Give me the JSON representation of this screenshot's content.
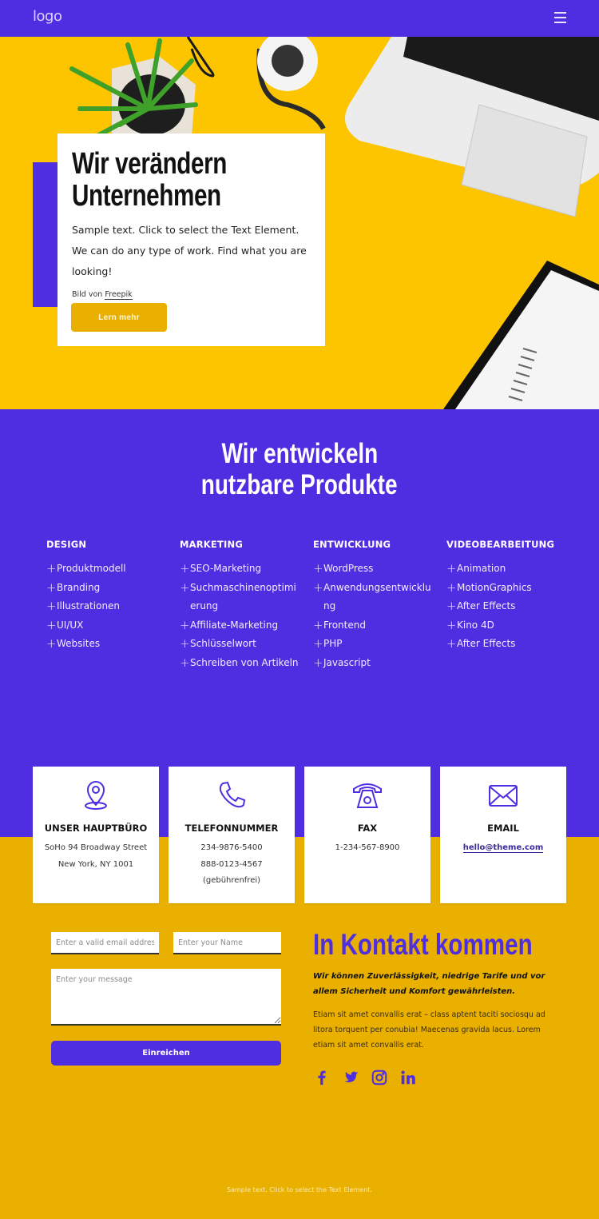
{
  "header": {
    "logo": "logo",
    "menu_icon": "hamburger-menu-icon"
  },
  "hero": {
    "title_line1": "Wir verändern",
    "title_line2": "Unternehmen",
    "text": "Sample text. Click to select the Text Element. We can do any type of work. Find what you are looking!",
    "credit_prefix": "Bild von",
    "credit_link": "Freepik",
    "button": "Lern mehr"
  },
  "products": {
    "title_line1": "Wir entwickeln",
    "title_line2": "nutzbare Produkte",
    "columns": [
      {
        "heading": "DESIGN",
        "items": [
          "Produktmodell",
          "Branding",
          "Illustrationen",
          "UI/UX",
          "Websites"
        ]
      },
      {
        "heading": "MARKETING",
        "items": [
          "SEO-Marketing",
          "Suchmaschinenoptimierung",
          "Affiliate-Marketing",
          "Schlüsselwort",
          "Schreiben von Artikeln"
        ]
      },
      {
        "heading": "ENTWICKLUNG",
        "items": [
          "WordPress",
          "Anwendungsentwicklung",
          "Frontend",
          "PHP",
          "Javascript"
        ]
      },
      {
        "heading": "VIDEOBEARBEITUNG",
        "items": [
          "Animation",
          "MotionGraphics",
          "After Effects",
          "Kino 4D",
          "After Effects"
        ]
      }
    ]
  },
  "contact_cards": [
    {
      "icon": "map-pin-icon",
      "title": "UNSER HAUPTBÜRO",
      "lines": [
        "SoHo 94 Broadway Street",
        "New York, NY 1001"
      ]
    },
    {
      "icon": "phone-icon",
      "title": "TELEFONNUMMER",
      "lines": [
        "234-9876-5400",
        "888-0123-4567",
        "(gebührenfrei)"
      ]
    },
    {
      "icon": "fax-telephone-icon",
      "title": "FAX",
      "lines": [
        "1-234-567-8900"
      ]
    },
    {
      "icon": "envelope-icon",
      "title": "EMAIL",
      "link": "hello@theme.com"
    }
  ],
  "form": {
    "email_placeholder": "Enter a valid email address",
    "name_placeholder": "Enter your Name",
    "message_placeholder": "Enter your message",
    "submit": "Einreichen"
  },
  "contact": {
    "title": "In Kontakt kommen",
    "lead": "Wir können Zuverlässigkeit, niedrige Tarife und vor allem Sicherheit und Komfort gewährleisten.",
    "body": "Etiam sit amet convallis erat – class aptent taciti sociosqu ad litora torquent per conubia! Maecenas gravida lacus. Lorem etiam sit amet convallis erat.",
    "socials": [
      "facebook",
      "twitter",
      "instagram",
      "linkedin"
    ]
  },
  "footer": {
    "text": "Sample text. Click to select the Text Element."
  },
  "colors": {
    "primary": "#4f2ee2",
    "hero_yellow": "#fdc400",
    "accent_yellow": "#e9b000"
  }
}
